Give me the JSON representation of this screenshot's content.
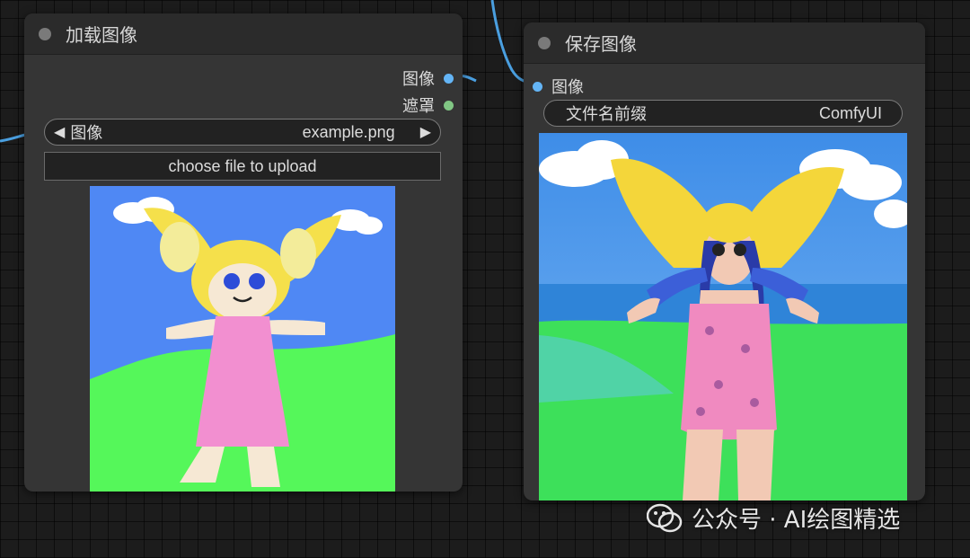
{
  "load_node": {
    "title": "加载图像",
    "outputs": [
      {
        "label": "图像",
        "color": "#64b5f6"
      },
      {
        "label": "遮罩",
        "color": "#81c784"
      }
    ],
    "image_widget": {
      "label": "图像",
      "value": "example.png",
      "left_arrow": "◀",
      "right_arrow": "▶"
    },
    "upload_button": "choose file to upload"
  },
  "save_node": {
    "title": "保存图像",
    "input": {
      "label": "图像",
      "color": "#64b5f6"
    },
    "prefix_widget": {
      "label": "文件名前缀",
      "value": "ComfyUI"
    }
  },
  "watermark": {
    "text": "公众号 · AI绘图精选"
  },
  "colors": {
    "wire": "#4a9fe0",
    "node_bg": "#353535",
    "header_bg": "#2b2b2b"
  }
}
